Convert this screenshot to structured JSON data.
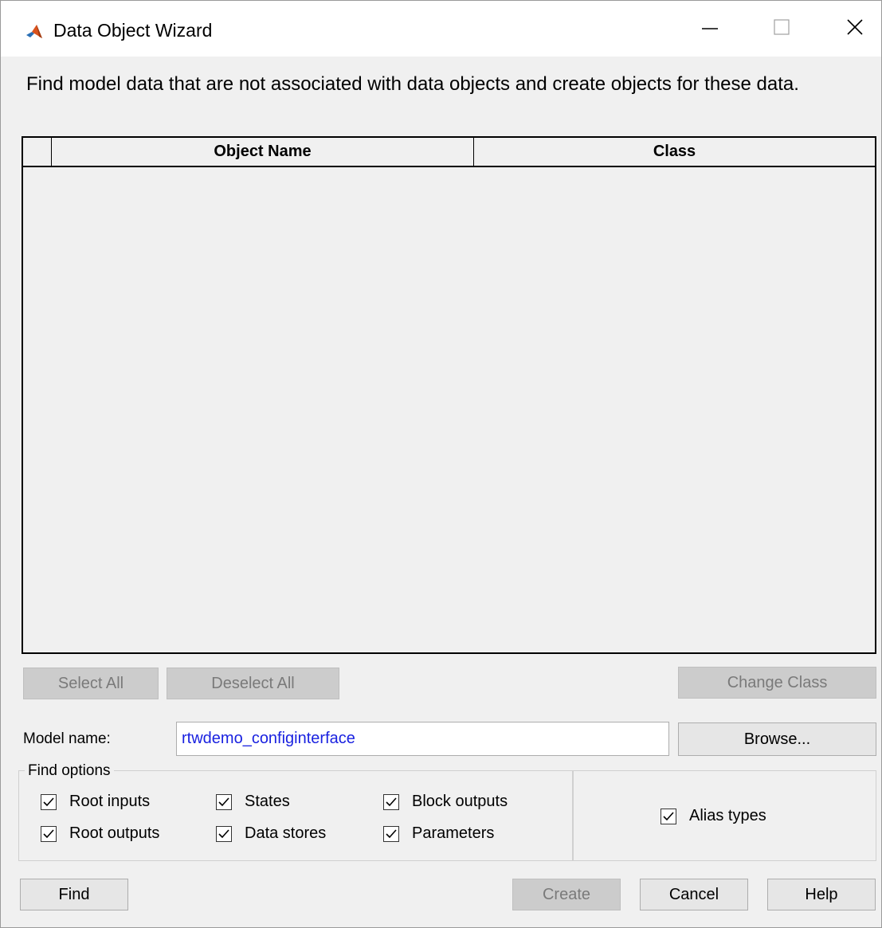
{
  "window": {
    "title": "Data Object Wizard"
  },
  "description": "Find model data that are not associated with data objects and create objects for these data.",
  "table": {
    "columns": [
      "",
      "Object Name",
      "Class"
    ],
    "rows": []
  },
  "buttons": {
    "select_all": "Select All",
    "deselect_all": "Deselect All",
    "change_class": "Change Class",
    "browse": "Browse...",
    "find": "Find",
    "create": "Create",
    "cancel": "Cancel",
    "help": "Help"
  },
  "model": {
    "label": "Model name:",
    "value": "rtwdemo_configinterface"
  },
  "find_options": {
    "legend": "Find options",
    "items": [
      {
        "label": "Root inputs",
        "checked": true
      },
      {
        "label": "Root outputs",
        "checked": true
      },
      {
        "label": "States",
        "checked": true
      },
      {
        "label": "Data stores",
        "checked": true
      },
      {
        "label": "Block outputs",
        "checked": true
      },
      {
        "label": "Parameters",
        "checked": true
      }
    ],
    "alias_types": {
      "label": "Alias types",
      "checked": true
    }
  },
  "icons": {
    "app": "matlab-logo-icon",
    "minimize": "minimize-icon",
    "maximize": "maximize-icon",
    "close": "close-icon",
    "check": "checkmark-icon"
  }
}
